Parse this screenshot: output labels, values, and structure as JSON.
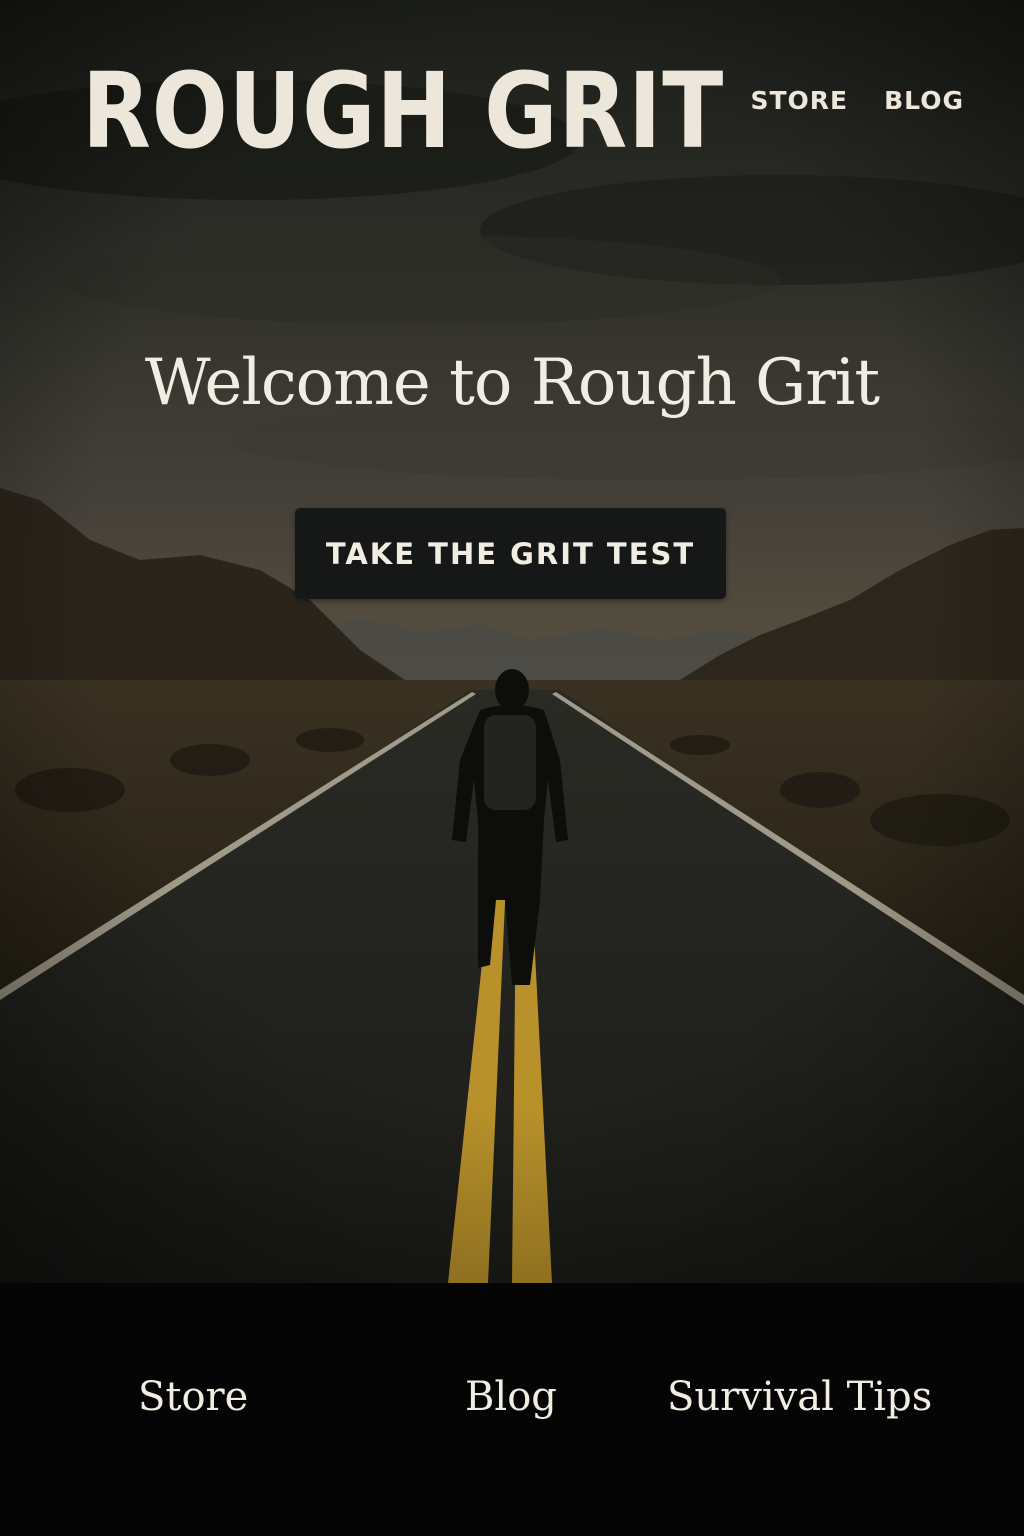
{
  "header": {
    "logo": "ROUGH GRIT",
    "nav": [
      {
        "label": "STORE"
      },
      {
        "label": "BLOG"
      }
    ]
  },
  "hero": {
    "title": "Welcome to Rough Grit",
    "cta_label": "TAKE THE GRIT TEST",
    "image": "hiker-walking-desert-road-photo"
  },
  "footer": {
    "links": [
      {
        "label": "Store"
      },
      {
        "label": "Blog"
      },
      {
        "label": "Survival Tips"
      }
    ]
  },
  "colors": {
    "text": "#f2ede2",
    "button_bg": "#151816",
    "footer_bg": "#050505",
    "road_line": "#b8912a"
  }
}
